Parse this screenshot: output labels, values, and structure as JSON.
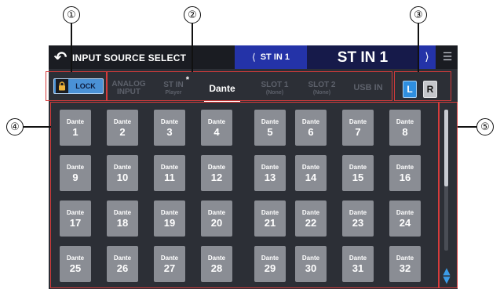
{
  "callouts": [
    "①",
    "②",
    "③",
    "④",
    "⑤"
  ],
  "header": {
    "title": "INPUT SOURCE SELECT",
    "prev_channel": "ST IN 1",
    "channel_name": "ST IN 1",
    "prev_icon": "chevron-left-icon",
    "next_icon": "chevron-right-icon",
    "back_icon": "back-arrow-icon",
    "menu_icon": "menu-icon"
  },
  "lock": {
    "label": "LOCK",
    "icon": "lock-icon"
  },
  "tabs": [
    {
      "line1": "ANALOG",
      "line2": "INPUT",
      "active": false
    },
    {
      "line1": "ST IN",
      "line2": "Player",
      "active": false,
      "marker": "*"
    },
    {
      "line1": "Dante",
      "line2": "",
      "active": true
    },
    {
      "line1": "SLOT 1",
      "line2": "(None)",
      "active": false
    },
    {
      "line1": "SLOT 2",
      "line2": "(None)",
      "active": false
    },
    {
      "line1": "USB IN",
      "line2": "",
      "active": false
    }
  ],
  "lr": {
    "left": "L",
    "right": "R",
    "selected": "L"
  },
  "sources": {
    "label": "Dante",
    "numbers": [
      "1",
      "2",
      "3",
      "4",
      "5",
      "6",
      "7",
      "8",
      "9",
      "10",
      "11",
      "12",
      "13",
      "14",
      "15",
      "16",
      "17",
      "18",
      "19",
      "20",
      "21",
      "22",
      "23",
      "24",
      "25",
      "26",
      "27",
      "28",
      "29",
      "30",
      "31",
      "32"
    ]
  },
  "colors": {
    "header_bg": "#1a1c22",
    "panel_bg": "#2c2f36",
    "prev_bg": "#2433a8",
    "name_bg": "#161a4a",
    "source_btn": "#8a8d94",
    "accent_blue": "#2f8fe0",
    "annotation": "#d63b3b"
  }
}
